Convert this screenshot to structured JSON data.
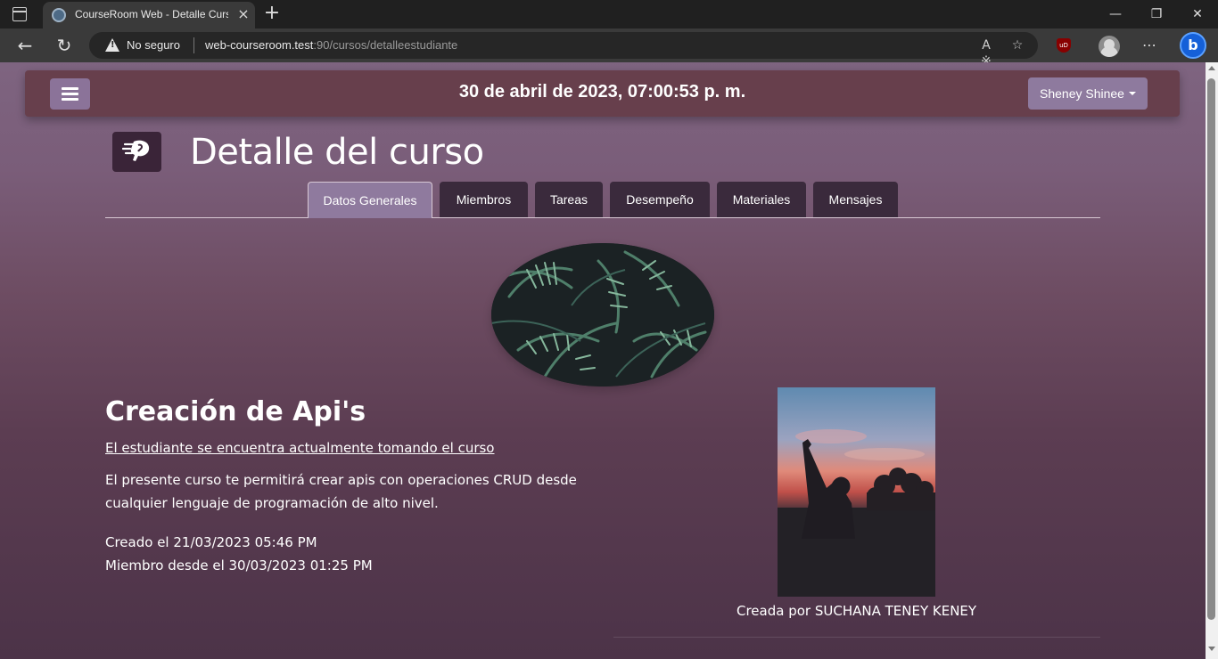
{
  "browser": {
    "tab_title": "CourseRoom Web - Detalle Curso",
    "tab_close": "×",
    "new_tab": "+",
    "security_label": "No seguro",
    "url_host": "web-courseroom.test",
    "url_rest": ":90/cursos/detalleestudiante"
  },
  "navbar": {
    "datetime": "30 de abril de 2023, 07:00:53 p. m.",
    "user_name": "Sheney Shinee"
  },
  "page": {
    "title": "Detalle del curso"
  },
  "tabs": [
    {
      "label": "Datos Generales",
      "active": true
    },
    {
      "label": "Miembros",
      "active": false
    },
    {
      "label": "Tareas",
      "active": false
    },
    {
      "label": "Desempeño",
      "active": false
    },
    {
      "label": "Materiales",
      "active": false
    },
    {
      "label": "Mensajes",
      "active": false
    }
  ],
  "course": {
    "name": "Creación de Api's",
    "status": "El estudiante se encuentra actualmente tomando el curso",
    "description": "El presente curso te permitirá crear apis con operaciones CRUD desde cualquier lenguaje de programación de alto nivel.",
    "created": "Creado el 21/03/2023 05:46 PM",
    "member_since": "Miembro desde el 30/03/2023 01:25 PM",
    "author_caption": "Creada por SUCHANA TENEY KENEY"
  },
  "colors": {
    "navbar": "#673f4c",
    "accent_button": "#8e7a9e",
    "tab_inactive": "#3a2a3c",
    "tab_active": "#8f7a9e"
  }
}
